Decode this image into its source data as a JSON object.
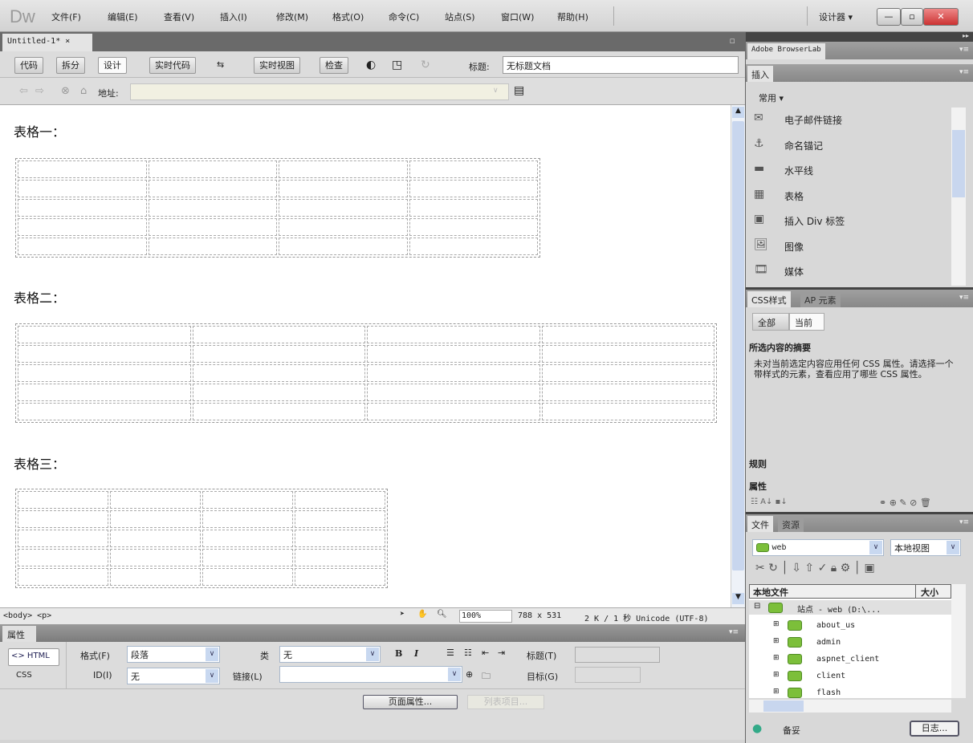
{
  "app": {
    "logo": "Dw",
    "workspace": "设计器 ▾"
  },
  "menu": [
    "文件(F)",
    "编辑(E)",
    "查看(V)",
    "插入(I)",
    "修改(M)",
    "格式(O)",
    "命令(C)",
    "站点(S)",
    "窗口(W)",
    "帮助(H)"
  ],
  "doc_tab": {
    "label": "Untitled-1*",
    "close": "×"
  },
  "toolbar": {
    "code": "代码",
    "split": "拆分",
    "design": "设计",
    "live_code": "实时代码",
    "live_view": "实时视图",
    "inspect": "检查",
    "title_label": "标题:",
    "title_value": "无标题文档"
  },
  "address": {
    "label": "地址:",
    "value": ""
  },
  "content": {
    "tables": [
      {
        "heading": "表格一：",
        "rows": 5,
        "cols": 4
      },
      {
        "heading": "表格二：",
        "rows": 5,
        "cols": 4
      },
      {
        "heading": "表格三：",
        "rows": 5,
        "cols": 4
      }
    ]
  },
  "status": {
    "tags": "<body> <p>",
    "zoom": "100%",
    "size": "788 x 531",
    "doc": "2 K / 1 秒 Unicode (UTF-8)"
  },
  "properties": {
    "title": "属性",
    "html": "<> HTML",
    "css": "CSS",
    "format_label": "格式(F)",
    "format_value": "段落",
    "class_label": "类",
    "class_value": "无",
    "id_label": "ID(I)",
    "id_value": "无",
    "link_label": "链接(L)",
    "link_value": "",
    "bold": "B",
    "italic": "I",
    "heading_label": "标题(T)",
    "target_label": "目标(G)",
    "page_props": "页面属性...",
    "list_item": "列表项目..."
  },
  "panels": {
    "browserlab": "Adobe BrowserLab",
    "insert": {
      "tab": "插入",
      "category": "常用",
      "items": [
        "电子邮件链接",
        "命名锚记",
        "水平线",
        "表格",
        "插入 Div 标签",
        "图像",
        "媒体"
      ]
    },
    "css": {
      "tab1": "CSS样式",
      "tab2": "AP 元素",
      "all": "全部",
      "current": "当前",
      "summary_title": "所选内容的摘要",
      "summary_text": "未对当前选定内容应用任何 CSS 属性。请选择一个带样式的元素，查看应用了哪些 CSS 属性。",
      "rules": "规则",
      "props": "属性"
    },
    "files": {
      "tab1": "文件",
      "tab2": "资源",
      "site": "web",
      "view": "本地视图",
      "col_name": "本地文件",
      "col_size": "大小",
      "root": "站点 - web (D:\\...",
      "folders": [
        "about_us",
        "admin",
        "aspnet_client",
        "client",
        "flash"
      ],
      "status": "备妥",
      "log": "日志..."
    }
  }
}
